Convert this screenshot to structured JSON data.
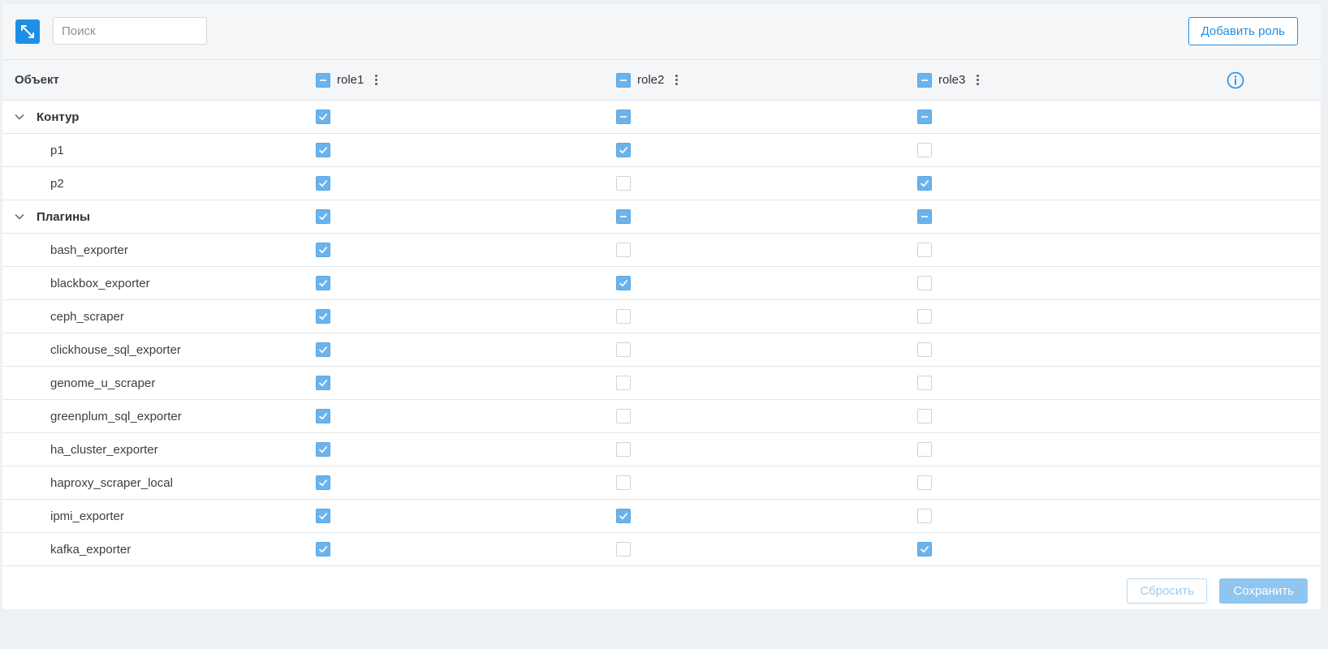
{
  "toolbar": {
    "search_placeholder": "Поиск",
    "add_role_label": "Добавить роль"
  },
  "table": {
    "object_header": "Объект",
    "roles": [
      "role1",
      "role2",
      "role3"
    ],
    "groups": [
      {
        "name": "Контур",
        "states": [
          "checked",
          "indeterminate",
          "indeterminate"
        ],
        "items": [
          {
            "name": "p1",
            "states": [
              "checked",
              "checked",
              "unchecked"
            ]
          },
          {
            "name": "p2",
            "states": [
              "checked",
              "unchecked",
              "checked"
            ]
          }
        ]
      },
      {
        "name": "Плагины",
        "states": [
          "checked",
          "indeterminate",
          "indeterminate"
        ],
        "items": [
          {
            "name": "bash_exporter",
            "states": [
              "checked",
              "unchecked",
              "unchecked"
            ]
          },
          {
            "name": "blackbox_exporter",
            "states": [
              "checked",
              "checked",
              "unchecked"
            ]
          },
          {
            "name": "ceph_scraper",
            "states": [
              "checked",
              "unchecked",
              "unchecked"
            ]
          },
          {
            "name": "clickhouse_sql_exporter",
            "states": [
              "checked",
              "unchecked",
              "unchecked"
            ]
          },
          {
            "name": "genome_u_scraper",
            "states": [
              "checked",
              "unchecked",
              "unchecked"
            ]
          },
          {
            "name": "greenplum_sql_exporter",
            "states": [
              "checked",
              "unchecked",
              "unchecked"
            ]
          },
          {
            "name": "ha_cluster_exporter",
            "states": [
              "checked",
              "unchecked",
              "unchecked"
            ]
          },
          {
            "name": "haproxy_scraper_local",
            "states": [
              "checked",
              "unchecked",
              "unchecked"
            ]
          },
          {
            "name": "ipmi_exporter",
            "states": [
              "checked",
              "checked",
              "unchecked"
            ]
          },
          {
            "name": "kafka_exporter",
            "states": [
              "checked",
              "unchecked",
              "checked"
            ]
          }
        ]
      }
    ]
  },
  "footer": {
    "reset_label": "Сбросить",
    "save_label": "Сохранить"
  },
  "colors": {
    "accent": "#1f8fe6",
    "checkbox_on": "#6bb3ec"
  }
}
